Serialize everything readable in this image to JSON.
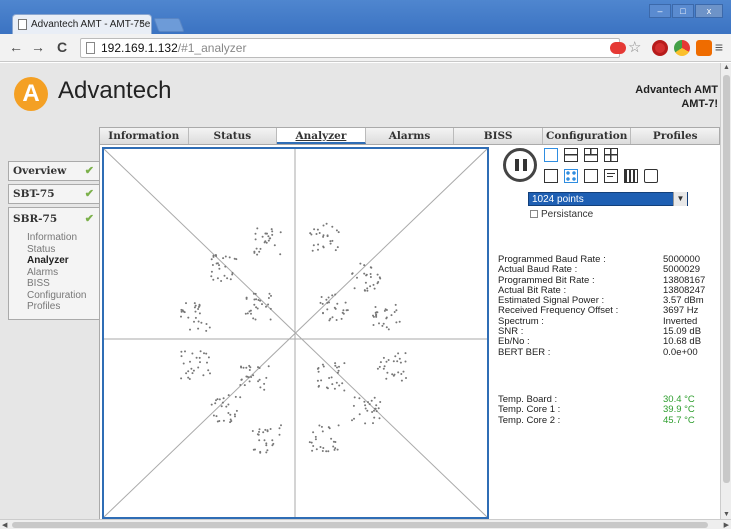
{
  "browser": {
    "tab_title": "Advantech AMT - AMT-75e",
    "tab_close": "×",
    "url_host": "192.169.1.132",
    "url_path": "/#1_analyzer",
    "window_buttons": [
      "–",
      "□",
      "x"
    ]
  },
  "header": {
    "logo_letter": "A",
    "brand": "Advantech",
    "device_line1": "Advantech AMT",
    "device_line2": "AMT-7!"
  },
  "tabs": [
    {
      "label": "Information",
      "active": false
    },
    {
      "label": "Status",
      "active": false
    },
    {
      "label": "Analyzer",
      "active": true
    },
    {
      "label": "Alarms",
      "active": false
    },
    {
      "label": "BISS",
      "active": false
    },
    {
      "label": "Configuration",
      "active": false
    },
    {
      "label": "Profiles",
      "active": false
    }
  ],
  "sidebar": {
    "overview": "Overview",
    "sbt": "SBT-75",
    "sbr": "SBR-75",
    "check": "✔",
    "sbr_items": [
      {
        "label": "Information",
        "active": false
      },
      {
        "label": "Status",
        "active": false
      },
      {
        "label": "Analyzer",
        "active": true
      },
      {
        "label": "Alarms",
        "active": false
      },
      {
        "label": "BISS",
        "active": false
      },
      {
        "label": "Configuration",
        "active": false
      },
      {
        "label": "Profiles",
        "active": false
      }
    ]
  },
  "analyzer": {
    "points_option": "1024 points",
    "persistance_label": "Persistance",
    "persistance_checked": false
  },
  "stats": [
    {
      "key": "Programmed Baud Rate :",
      "value": "5000000"
    },
    {
      "key": "Actual Baud Rate :",
      "value": "5000029"
    },
    {
      "key": "Programmed Bit Rate :",
      "value": "13808167"
    },
    {
      "key": "Actual Bit Rate :",
      "value": "13808247"
    },
    {
      "key": "Estimated Signal Power :",
      "value": "3.57 dBm"
    },
    {
      "key": "Received Frequency Offset :",
      "value": "3697 Hz"
    },
    {
      "key": "Spectrum :",
      "value": "Inverted"
    },
    {
      "key": "SNR :",
      "value": "15.09 dB"
    },
    {
      "key": "Eb/No :",
      "value": "10.68 dB"
    },
    {
      "key": "BERT BER :",
      "value": "0.0e+00"
    }
  ],
  "temps": [
    {
      "key": "Temp. Board :",
      "value": "30.4 °C"
    },
    {
      "key": "Temp. Core 1 :",
      "value": "39.9 °C"
    },
    {
      "key": "Temp. Core 2 :",
      "value": "45.7 °C"
    }
  ],
  "colors": {
    "accent": "#2f6db5",
    "logo": "#f4a024",
    "ok_green": "#2e9e2e"
  },
  "icons": {
    "back": "←",
    "forward": "→",
    "reload": "C",
    "star": "☆",
    "menu": "≡"
  }
}
